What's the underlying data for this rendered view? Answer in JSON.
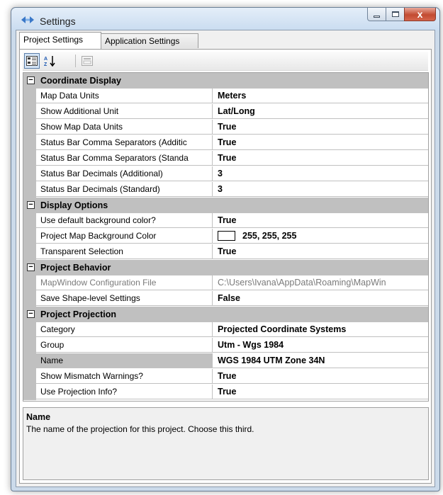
{
  "window": {
    "title": "Settings",
    "minimize_label": "–",
    "maximize_label": "□",
    "close_label": "x"
  },
  "tabs": [
    {
      "label": "Project Settings",
      "active": true
    },
    {
      "label": "Application Settings",
      "active": false
    }
  ],
  "toolbar": {
    "categorized_icon": "categorized-icon",
    "alphabetical_icon": "alphabetical-sort-icon",
    "property_pages_icon": "property-pages-icon"
  },
  "grid": {
    "categories": [
      {
        "label": "Coordinate Display",
        "toggle": "⊟",
        "properties": [
          {
            "name": "Map Data Units",
            "value": "Meters"
          },
          {
            "name": "Show Additional Unit",
            "value": "Lat/Long"
          },
          {
            "name": "Show Map Data Units",
            "value": "True"
          },
          {
            "name": "Status Bar Comma Separators (Additic",
            "value": "True"
          },
          {
            "name": "Status Bar Comma Separators (Standa",
            "value": "True"
          },
          {
            "name": "Status Bar Decimals (Additional)",
            "value": "3"
          },
          {
            "name": "Status Bar Decimals (Standard)",
            "value": "3"
          }
        ]
      },
      {
        "label": "Display Options",
        "toggle": "⊟",
        "properties": [
          {
            "name": "Use default background color?",
            "value": "True"
          },
          {
            "name": "Project Map Background Color",
            "value": "255, 255, 255",
            "swatch": "#ffffff"
          },
          {
            "name": "Transparent Selection",
            "value": "True"
          }
        ]
      },
      {
        "label": "Project Behavior",
        "toggle": "⊟",
        "properties": [
          {
            "name": "MapWindow Configuration File",
            "value": "C:\\Users\\Ivana\\AppData\\Roaming\\MapWin",
            "readonly": true
          },
          {
            "name": "Save Shape-level Settings",
            "value": "False"
          }
        ]
      },
      {
        "label": "Project Projection",
        "toggle": "⊟",
        "properties": [
          {
            "name": "Category",
            "value": "Projected Coordinate Systems"
          },
          {
            "name": "Group",
            "value": "Utm - Wgs 1984"
          },
          {
            "name": "Name",
            "value": "WGS 1984 UTM Zone 34N",
            "selected": true
          },
          {
            "name": "Show Mismatch Warnings?",
            "value": "True"
          },
          {
            "name": "Use Projection Info?",
            "value": "True"
          }
        ]
      }
    ]
  },
  "help": {
    "title": "Name",
    "description": "The name of the projection for this project. Choose this third."
  }
}
